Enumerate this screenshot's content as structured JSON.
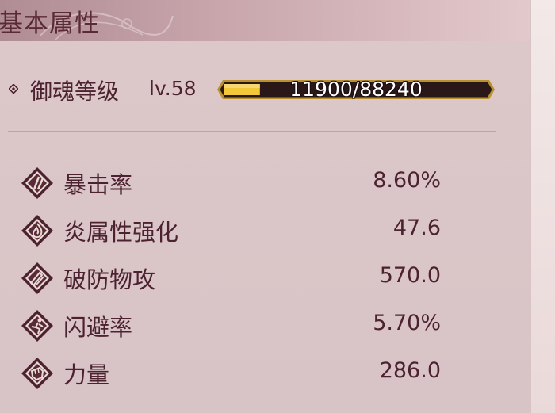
{
  "header": {
    "title": "基本属性"
  },
  "level": {
    "label": "御魂等级",
    "value": "lv.58",
    "exp_text": "11900/88240",
    "exp_current": 11900,
    "exp_max": 88240
  },
  "stats": [
    {
      "label": "暴击率",
      "value": "8.60%",
      "icon": "crit-rate-icon"
    },
    {
      "label": "炎属性强化",
      "value": "47.6",
      "icon": "fire-element-icon"
    },
    {
      "label": "破防物攻",
      "value": "570.0",
      "icon": "armor-break-icon"
    },
    {
      "label": "闪避率",
      "value": "5.70%",
      "icon": "dodge-rate-icon"
    },
    {
      "label": "力量",
      "value": "286.0",
      "icon": "strength-fist-icon"
    }
  ],
  "colors": {
    "text": "#4d2230",
    "panel": "#dcc8c9",
    "exp_fill": "#f2c73a",
    "exp_frame": "#b8902e"
  }
}
